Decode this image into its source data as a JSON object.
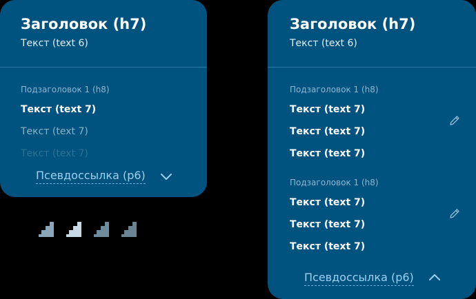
{
  "collapsed_card": {
    "title": "Заголовок (h7)",
    "subtitle": "Текст (text 6)",
    "subheading": "Подзаголовок 1 (h8)",
    "items": [
      "Текст (text 7)",
      "Текст (text 7)",
      "Текст (text 7)"
    ],
    "pseudolink": "Псевдоссылка (p6)",
    "chevron_icon": "chevron-down-icon"
  },
  "expanded_card": {
    "title": "Заголовок (h7)",
    "subtitle": "Текст (text 6)",
    "groups": [
      {
        "subheading": "Подзаголовок 1 (h8)",
        "items": [
          "Текст (text 7)",
          "Текст (text 7)",
          "Текст (text 7)"
        ],
        "edit_icon": "pencil-icon"
      },
      {
        "subheading": "Подзаголовок 1 (h8)",
        "items": [
          "Текст (text 7)",
          "Текст (text 7)",
          "Текст (text 7)"
        ],
        "edit_icon": "pencil-icon"
      }
    ],
    "pseudolink": "Псевдоссылка (p6)",
    "chevron_icon": "chevron-up-icon"
  },
  "indicators": [
    {
      "icon": "corner-indicator-icon",
      "color": "#8aa6b8"
    },
    {
      "icon": "corner-indicator-icon",
      "color": "#c7d9e4"
    },
    {
      "icon": "corner-indicator-icon",
      "color": "#6f8c9c"
    },
    {
      "icon": "corner-indicator-icon",
      "color": "#6a8494"
    }
  ],
  "colors": {
    "card_bg": "#00527f",
    "background": "#000000",
    "link": "#9fd0f2",
    "subheading": "#8fb7d4"
  }
}
